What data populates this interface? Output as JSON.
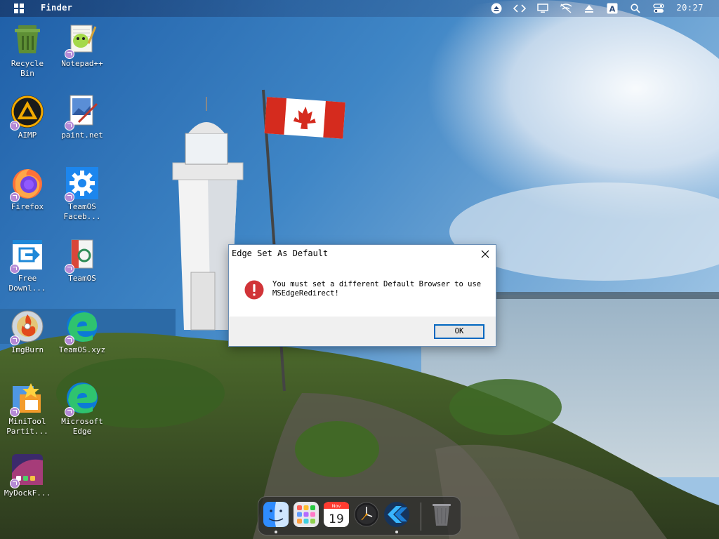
{
  "menubar": {
    "app_name": "Finder",
    "clock": "20:27",
    "tray_icons": [
      "eject-icon",
      "code-icon",
      "display-icon",
      "network-off-icon",
      "upload-icon",
      "keyboard-a-icon",
      "search-icon",
      "control-center-icon"
    ],
    "tray_letter": "A"
  },
  "desktop": {
    "icons": [
      {
        "label": "Recycle\nBin",
        "icon": "recycle-bin-icon"
      },
      {
        "label": "Notepad++",
        "icon": "notepadpp-icon"
      },
      {
        "label": "AIMP",
        "icon": "aimp-icon"
      },
      {
        "label": "paint.net",
        "icon": "paintnet-icon"
      },
      {
        "label": "Firefox",
        "icon": "firefox-icon"
      },
      {
        "label": "TeamOS\nFaceb...",
        "icon": "settings-gear-icon"
      },
      {
        "label": "Free\nDownl...",
        "icon": "free-download-icon"
      },
      {
        "label": "TeamOS",
        "icon": "teamos-icon"
      },
      {
        "label": "ImgBurn",
        "icon": "imgburn-icon"
      },
      {
        "label": "TeamOS.xyz",
        "icon": "edge-icon"
      },
      {
        "label": "MiniTool\nPartit...",
        "icon": "minitool-icon"
      },
      {
        "label": "Microsoft\nEdge",
        "icon": "edge-icon"
      },
      {
        "label": "MyDockF...",
        "icon": "mydock-icon"
      }
    ]
  },
  "dialog": {
    "title": "Edge Set As Default",
    "message_line1": "You must set a different Default Browser to use",
    "message_line2": "MSEdgeRedirect!",
    "ok_label": "OK"
  },
  "dock": {
    "items": [
      "finder-icon",
      "launchpad-icon",
      "calendar-icon",
      "clock-icon",
      "edge-redirect-icon",
      "trash-icon"
    ],
    "calendar_month": "Nov",
    "calendar_day": "19"
  },
  "colors": {
    "dialog_border": "#6b8fb6",
    "ok_border": "#0067c0",
    "error_red": "#d13438"
  }
}
